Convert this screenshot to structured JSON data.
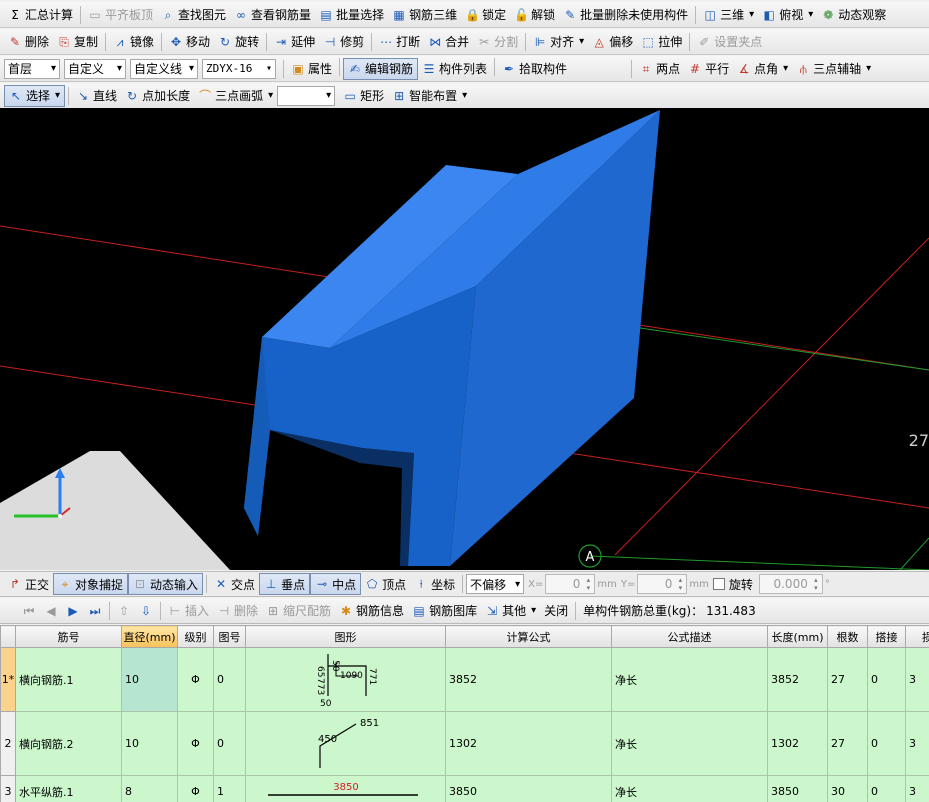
{
  "toolbar1": [
    {
      "id": "summary",
      "label": "汇总计算",
      "icon": "Σ",
      "cls": ""
    },
    {
      "id": "flatten-slab",
      "label": "平齐板顶",
      "icon": "▭",
      "cls": "gray",
      "disabled": true
    },
    {
      "id": "find-element",
      "label": "查找图元",
      "icon": "⌕",
      "cls": "blue"
    },
    {
      "id": "view-rebar-qty",
      "label": "查看钢筋量",
      "icon": "∞",
      "cls": "blue"
    },
    {
      "id": "batch-select",
      "label": "批量选择",
      "icon": "▤",
      "cls": "blue"
    },
    {
      "id": "rebar-3d",
      "label": "钢筋三维",
      "icon": "▦",
      "cls": "blue"
    },
    {
      "id": "lock",
      "label": "锁定",
      "icon": "🔒",
      "cls": "orange"
    },
    {
      "id": "unlock",
      "label": "解锁",
      "icon": "🔓",
      "cls": "orange"
    },
    {
      "id": "batch-delete-unused",
      "label": "批量删除未使用构件",
      "icon": "✎",
      "cls": "blue"
    },
    {
      "id": "view-3d",
      "label": "三维",
      "icon": "◫",
      "cls": "blue",
      "caret": true
    },
    {
      "id": "top-view",
      "label": "俯视",
      "icon": "◧",
      "cls": "blue",
      "caret": true
    },
    {
      "id": "dynamic-observe",
      "label": "动态观察",
      "icon": "❁",
      "cls": "green"
    }
  ],
  "toolbar2": [
    {
      "id": "delete",
      "label": "删除",
      "icon": "✎",
      "cls": "red"
    },
    {
      "id": "copy",
      "label": "复制",
      "icon": "⎘",
      "cls": "red"
    },
    {
      "id": "mirror",
      "label": "镜像",
      "icon": "⩘",
      "cls": "blue"
    },
    {
      "id": "move",
      "label": "移动",
      "icon": "✥",
      "cls": "blue"
    },
    {
      "id": "rotate",
      "label": "旋转",
      "icon": "↻",
      "cls": "blue"
    },
    {
      "id": "extend",
      "label": "延伸",
      "icon": "⇥",
      "cls": "blue"
    },
    {
      "id": "trim",
      "label": "修剪",
      "icon": "⊣",
      "cls": "blue"
    },
    {
      "id": "break",
      "label": "打断",
      "icon": "⋯",
      "cls": "blue"
    },
    {
      "id": "merge",
      "label": "合并",
      "icon": "⋈",
      "cls": "blue"
    },
    {
      "id": "split",
      "label": "分割",
      "icon": "✂",
      "cls": "gray",
      "disabled": true
    },
    {
      "id": "align",
      "label": "对齐",
      "icon": "⊫",
      "cls": "blue",
      "caret": true
    },
    {
      "id": "offset",
      "label": "偏移",
      "icon": "◬",
      "cls": "red"
    },
    {
      "id": "stretch",
      "label": "拉伸",
      "icon": "⬚",
      "cls": "blue"
    },
    {
      "id": "set-grip",
      "label": "设置夹点",
      "icon": "✐",
      "cls": "gray",
      "disabled": true
    }
  ],
  "toolbar3": {
    "floor": "首层",
    "category": "自定义",
    "subcategory": "自定义线",
    "element": "ZDYX-16",
    "buttons": [
      {
        "id": "properties",
        "label": "属性",
        "icon": "▣",
        "cls": "orange"
      },
      {
        "id": "edit-rebar",
        "label": "编辑钢筋",
        "icon": "✍",
        "cls": "blue",
        "pressed": true
      },
      {
        "id": "element-list",
        "label": "构件列表",
        "icon": "☰",
        "cls": "blue"
      },
      {
        "id": "pick-element",
        "label": "拾取构件",
        "icon": "✒",
        "cls": "blue"
      }
    ],
    "axis_buttons": [
      {
        "id": "two-points",
        "label": "两点",
        "icon": "⌗",
        "cls": "red"
      },
      {
        "id": "parallel",
        "label": "平行",
        "icon": "#",
        "cls": "red"
      },
      {
        "id": "point-angle",
        "label": "点角",
        "icon": "∡",
        "cls": "red",
        "caret": true
      },
      {
        "id": "three-point-aux",
        "label": "三点辅轴",
        "icon": "⫛",
        "cls": "red",
        "caret": true
      }
    ]
  },
  "toolbar4": {
    "select": "选择",
    "line": "直线",
    "point-length": "点加长度",
    "arc": "三点画弧",
    "arc_combo": "",
    "rect": "矩形",
    "smart_layout": "智能布置"
  },
  "viewport": {
    "axis_marker": "A",
    "side_number": "27",
    "colors": {
      "background": "#000000",
      "solid": "#1a6fd6",
      "grid_red": "#c8201c",
      "grid_green": "#1f9a2a"
    }
  },
  "snapbar": {
    "ortho": "正交",
    "object_snap": "对象捕捉",
    "dynamic_input": "动态输入",
    "intersection": "交点",
    "perpendicular": "垂点",
    "midpoint": "中点",
    "vertex": "顶点",
    "coordinate": "坐标",
    "offset_mode": "不偏移",
    "x_label": "X=",
    "x_value": "0",
    "y_label": "Y=",
    "y_value": "0",
    "unit": "mm",
    "rotate_label": "旋转",
    "rotate_value": "0.000",
    "degree": "°"
  },
  "navbar": {
    "insert": "插入",
    "delete": "删除",
    "scale_rebar": "缩尺配筋",
    "rebar_info": "钢筋信息",
    "rebar_library": "钢筋图库",
    "other": "其他",
    "close": "关闭",
    "total_weight_label": "单构件钢筋总重(kg)：",
    "total_weight": "131.483"
  },
  "table": {
    "headers": [
      "",
      "筋号",
      "直径(mm)",
      "级别",
      "图号",
      "图形",
      "计算公式",
      "公式描述",
      "长度(mm)",
      "根数",
      "搭接",
      "损耗"
    ],
    "rows": [
      {
        "num": "1*",
        "name": "横向钢筋.1",
        "diameter": "10",
        "grade": "Φ",
        "figure_no": "0",
        "formula": "3852",
        "desc": "净长",
        "length": "3852",
        "count": "27",
        "lap": "0",
        "loss": "3",
        "shape_labels": {
          "a": "65",
          "b": "773",
          "c": "50",
          "d": "1090",
          "e": "771",
          "f": "50"
        }
      },
      {
        "num": "2",
        "name": "横向钢筋.2",
        "diameter": "10",
        "grade": "Φ",
        "figure_no": "0",
        "formula": "1302",
        "desc": "净长",
        "length": "1302",
        "count": "27",
        "lap": "0",
        "loss": "3",
        "shape_labels": {
          "a": "450",
          "b": "851"
        }
      },
      {
        "num": "3",
        "name": "水平纵筋.1",
        "diameter": "8",
        "grade": "Φ",
        "figure_no": "1",
        "formula": "3850",
        "desc": "净长",
        "length": "3850",
        "count": "30",
        "lap": "0",
        "loss": "3",
        "shape_labels": {
          "a": "3850"
        }
      }
    ]
  }
}
